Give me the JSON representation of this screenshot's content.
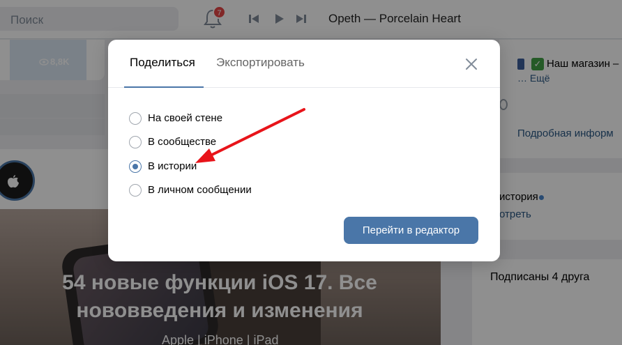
{
  "header": {
    "search_placeholder": "Поиск",
    "notifications_count": "7",
    "now_playing": "Opeth — Porcelain Heart"
  },
  "background": {
    "views": "8,8K",
    "post_title": "54 новые функции iOS 17. Все нововведения и изменения",
    "post_tags": "Apple | iPhone | iPad",
    "shop_text": "Наш магазин –",
    "more_link": "… Ещё",
    "info_link": "Подробная информ",
    "story_text": "история",
    "story_link": "отреть",
    "friends_text": "Подписаны 4 друга"
  },
  "modal": {
    "tabs": [
      {
        "label": "Поделиться",
        "active": true
      },
      {
        "label": "Экспортировать",
        "active": false
      }
    ],
    "options": [
      {
        "label": "На своей стене",
        "checked": false
      },
      {
        "label": "В сообществе",
        "checked": false
      },
      {
        "label": "В истории",
        "checked": true
      },
      {
        "label": "В личном сообщении",
        "checked": false
      }
    ],
    "primary_button": "Перейти в редактор"
  },
  "colors": {
    "accent": "#4a76a8",
    "annotation_arrow": "#e8141a",
    "badge": "#e64646"
  }
}
